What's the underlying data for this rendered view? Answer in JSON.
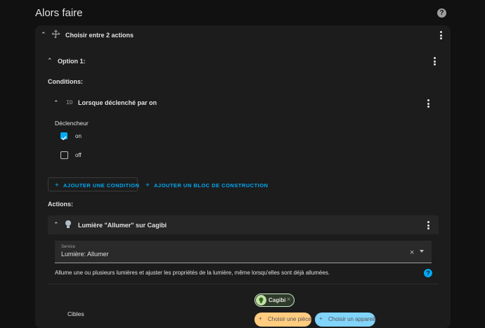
{
  "header": {
    "title": "Alors faire"
  },
  "choose": {
    "label": "Choisir entre 2 actions"
  },
  "option": {
    "label": "Option 1:"
  },
  "conditions": {
    "heading": "Conditions:"
  },
  "trigger_condition": {
    "label": "Lorsque déclenché par on",
    "icon_text": "ID"
  },
  "declencheur": {
    "heading": "Déclencheur",
    "options": [
      {
        "label": "on",
        "checked": true
      },
      {
        "label": "off",
        "checked": false
      }
    ]
  },
  "buttons": {
    "add_condition": "AJOUTER UNE CONDITION",
    "add_block": "AJOUTER UN BLOC DE CONSTRUCTION"
  },
  "actions": {
    "heading": "Actions:"
  },
  "action_item": {
    "label": "Lumière \"Allumer\" sur Cagibi"
  },
  "service": {
    "label": "Service",
    "value": "Lumière: Allumer",
    "description": "Allume une ou plusieurs lumières et ajuster les propriétés de la lumière, même lorsqu'elles sont déjà allumées."
  },
  "targets": {
    "label": "Cibles",
    "chip": "Cagibi",
    "choose_room": "Choisir une pièce",
    "choose_device": "Choisir un appareil"
  },
  "colors": {
    "accent": "#03a9f4",
    "background": "#111111",
    "card": "#1c1c1c"
  }
}
